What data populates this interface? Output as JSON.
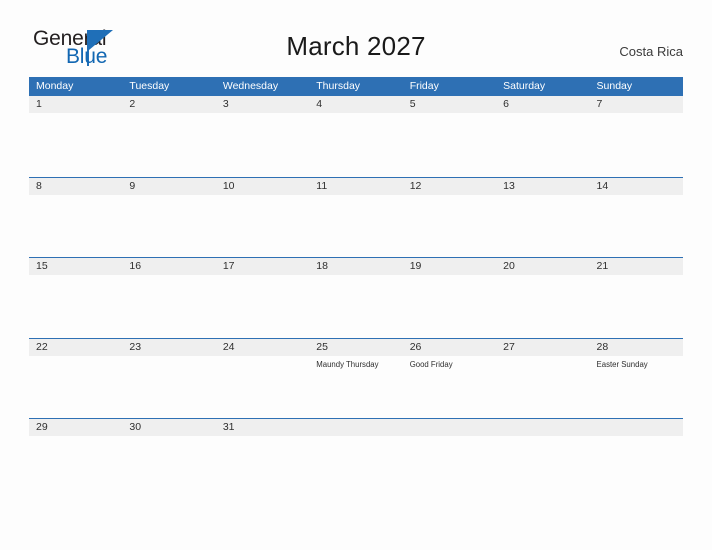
{
  "brand": {
    "name_part1": "General",
    "name_part2": "Blue",
    "flag_color": "#1f6fb8",
    "text_color": "#231f20",
    "blue_color": "#1267b2"
  },
  "header": {
    "title": "March 2027",
    "country": "Costa Rica",
    "accent_color": "#2e70b4",
    "band_color": "#efefef"
  },
  "calendar": {
    "weekday_headers": [
      "Monday",
      "Tuesday",
      "Wednesday",
      "Thursday",
      "Friday",
      "Saturday",
      "Sunday"
    ],
    "weeks": [
      [
        {
          "date": "1",
          "events": []
        },
        {
          "date": "2",
          "events": []
        },
        {
          "date": "3",
          "events": []
        },
        {
          "date": "4",
          "events": []
        },
        {
          "date": "5",
          "events": []
        },
        {
          "date": "6",
          "events": []
        },
        {
          "date": "7",
          "events": []
        }
      ],
      [
        {
          "date": "8",
          "events": []
        },
        {
          "date": "9",
          "events": []
        },
        {
          "date": "10",
          "events": []
        },
        {
          "date": "11",
          "events": []
        },
        {
          "date": "12",
          "events": []
        },
        {
          "date": "13",
          "events": []
        },
        {
          "date": "14",
          "events": []
        }
      ],
      [
        {
          "date": "15",
          "events": []
        },
        {
          "date": "16",
          "events": []
        },
        {
          "date": "17",
          "events": []
        },
        {
          "date": "18",
          "events": []
        },
        {
          "date": "19",
          "events": []
        },
        {
          "date": "20",
          "events": []
        },
        {
          "date": "21",
          "events": []
        }
      ],
      [
        {
          "date": "22",
          "events": []
        },
        {
          "date": "23",
          "events": []
        },
        {
          "date": "24",
          "events": []
        },
        {
          "date": "25",
          "events": [
            "Maundy Thursday"
          ]
        },
        {
          "date": "26",
          "events": [
            "Good Friday"
          ]
        },
        {
          "date": "27",
          "events": []
        },
        {
          "date": "28",
          "events": [
            "Easter Sunday"
          ]
        }
      ],
      [
        {
          "date": "29",
          "events": []
        },
        {
          "date": "30",
          "events": []
        },
        {
          "date": "31",
          "events": []
        },
        {
          "date": "",
          "events": []
        },
        {
          "date": "",
          "events": []
        },
        {
          "date": "",
          "events": []
        },
        {
          "date": "",
          "events": []
        }
      ]
    ]
  }
}
